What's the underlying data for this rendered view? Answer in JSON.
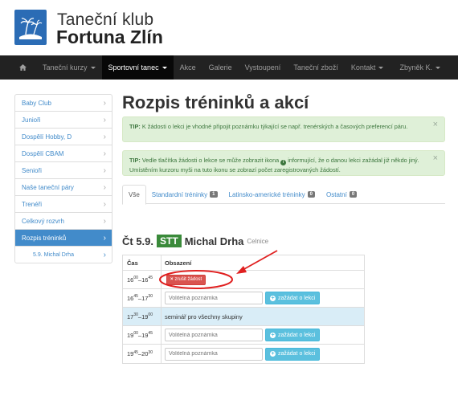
{
  "brand": {
    "line1": "Taneční klub",
    "line2": "Fortuna Zlín",
    "logo_icon": "palm-island-logo-icon"
  },
  "nav": {
    "home_icon": "home-icon",
    "items": [
      {
        "label": "Taneční kurzy",
        "dropdown": true,
        "active": false
      },
      {
        "label": "Sportovní tanec",
        "dropdown": true,
        "active": true
      },
      {
        "label": "Akce",
        "dropdown": false,
        "active": false
      },
      {
        "label": "Galerie",
        "dropdown": false,
        "active": false
      },
      {
        "label": "Vystoupení",
        "dropdown": false,
        "active": false
      },
      {
        "label": "Taneční zboží",
        "dropdown": false,
        "active": false
      },
      {
        "label": "Kontakt",
        "dropdown": true,
        "active": false
      }
    ],
    "user": "Zbyněk K."
  },
  "sidebar": {
    "items": [
      {
        "label": "Baby Club"
      },
      {
        "label": "Junioři"
      },
      {
        "label": "Dospělí Hobby, D"
      },
      {
        "label": "Dospělí CBAM"
      },
      {
        "label": "Senioři"
      },
      {
        "label": "Naše taneční páry"
      },
      {
        "label": "Trenéři"
      },
      {
        "label": "Celkový rozvrh"
      },
      {
        "label": "Rozpis tréninků"
      }
    ],
    "active_index": 8,
    "sub_item": "5.9. Michal Drha"
  },
  "page": {
    "title": "Rozpis tréninků a akcí"
  },
  "alerts": [
    {
      "tip": "TIP:",
      "text": "K žádosti o lekci je vhodné připojit poznámku týkající se např. trenérských a časových preferencí páru."
    },
    {
      "tip": "TIP:",
      "text_before": "Vedle tlačítka žádosti o lekce se může zobrazit ikona",
      "text_after": "informující, že o danou lekci zažádal již někdo jiný. Umístěním kurzoru myši na tuto ikonu se zobrazí počet zaregistrovaných žádostí."
    }
  ],
  "close_glyph": "×",
  "tabs": [
    {
      "label": "Vše",
      "active": true,
      "count": ""
    },
    {
      "label": "Standardní tréninky",
      "active": false,
      "count": "1"
    },
    {
      "label": "Latinsko-americké tréninky",
      "active": false,
      "count": "0"
    },
    {
      "label": "Ostatní",
      "active": false,
      "count": "0"
    }
  ],
  "day": {
    "date": "Čt 5.9.",
    "badge": "STT",
    "trainer": "Michal Drha",
    "venue": "Celnice"
  },
  "schedule": {
    "col_time": "Čas",
    "col_occupancy": "Obsazení",
    "placeholder": "Volitelná poznámka",
    "request_label": "zažádat o lekci",
    "cancel_label": "zrušit žádost",
    "rows": [
      {
        "start_h": "16",
        "start_m": "00",
        "end_h": "16",
        "end_m": "45",
        "type": "cancel"
      },
      {
        "start_h": "16",
        "start_m": "45",
        "end_h": "17",
        "end_m": "30",
        "type": "request"
      },
      {
        "start_h": "17",
        "start_m": "30",
        "end_h": "19",
        "end_m": "00",
        "type": "text",
        "text": "seminář pro všechny skupiny"
      },
      {
        "start_h": "19",
        "start_m": "00",
        "end_h": "19",
        "end_m": "45",
        "type": "request"
      },
      {
        "start_h": "19",
        "start_m": "45",
        "end_h": "20",
        "end_m": "30",
        "type": "request"
      }
    ]
  },
  "colors": {
    "accent": "#428bca",
    "navbar": "#222222",
    "success_bg": "#dff0d8",
    "info_btn": "#5bc0de",
    "danger": "#d9534f",
    "badge_green": "#3a8a3a",
    "annotation": "#e02020"
  }
}
